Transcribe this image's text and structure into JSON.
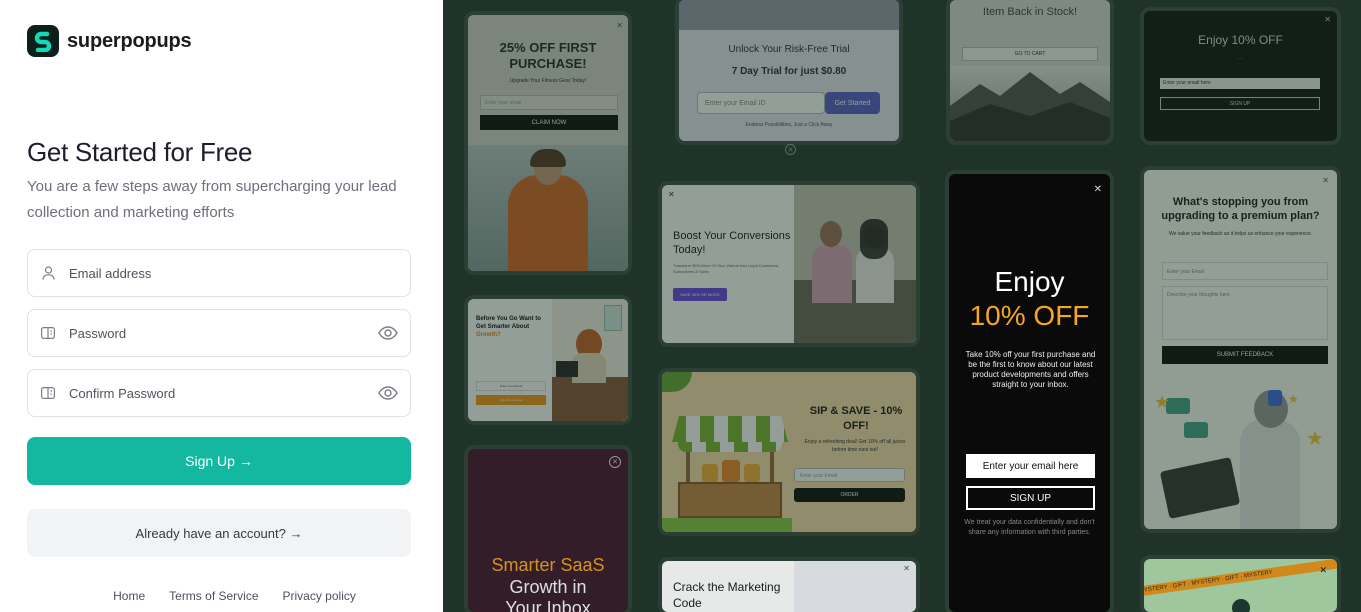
{
  "brand": {
    "name": "superpopups"
  },
  "signup": {
    "title": "Get Started for Free",
    "subtitle": "You are a few steps away from supercharging your lead collection and marketing efforts",
    "email_placeholder": "Email address",
    "password_placeholder": "Password",
    "confirm_placeholder": "Confirm Password",
    "submit_label": "Sign Up →",
    "login_label": "Already have an account? →"
  },
  "footer": {
    "links": [
      "Home",
      "Terms of Service",
      "Privacy policy"
    ]
  },
  "colors": {
    "accent": "#14b8a0",
    "panel_bg": "#1f3328"
  },
  "popups": {
    "p1": {
      "title": "25% OFF FIRST PURCHASE!",
      "sub": "Upgrade Your Fitness Gear Today!",
      "input": "Enter your email",
      "button": "CLAIM NOW"
    },
    "p2": {
      "title": "Unlock Your Risk-Free Trial",
      "line": "7 Day Trial for just $0.80",
      "input": "Enter your Email ID",
      "button": "Get Started",
      "foot": "Endless Possibilities, Just a Click Away"
    },
    "p3": {
      "title": "Item Back in Stock!",
      "button": "GO TO CART"
    },
    "p4": {
      "title": "Enjoy 10% OFF",
      "input": "Enter your email here",
      "button": "SIGN UP"
    },
    "p5": {
      "title": "Boost Your Conversions Today!",
      "body": "Transform 85% More Of Your Visitors Into Loyal Customers, Subscribers & Sales",
      "button": "SAVE 40% OR MORE"
    },
    "p6": {
      "title_a": "Enjoy",
      "title_b": "10% OFF",
      "body": "Take 10% off your first purchase and be the first to know about our latest product developments and offers straight to your inbox.",
      "input": "Enter your email here",
      "button": "SIGN UP",
      "foot": "We treat your data confidentially and don't share any information with third parties."
    },
    "p7": {
      "title": "What's stopping you from upgrading to a premium plan?",
      "sub": "We value your feedback as it helps us enhance your experience.",
      "input": "Enter your Email",
      "textarea": "Describe your thoughts here",
      "button": "SUBMIT FEEDBACK"
    },
    "p8": {
      "title_a": "Before You Go Want to Get Smarter About ",
      "title_b": "Growth?",
      "input": "Enter Your Email",
      "button": "Sign Me Up Now"
    },
    "p9": {
      "title": "SIP & SAVE - 10% OFF!",
      "body": "Enjoy a refreshing deal! Get 10% off all juices before time runs out!",
      "input": "Enter your Email",
      "button": "ORDER"
    },
    "p10": {
      "title_a": "Smarter SaaS",
      "title_b": "Growth in",
      "title_c": "Your Inbox"
    },
    "p11": {
      "title": "Crack the Marketing Code"
    },
    "p12": {
      "ribbon": "MYSTERY · GIFT · MYSTERY · GIFT · MYSTERY"
    }
  }
}
